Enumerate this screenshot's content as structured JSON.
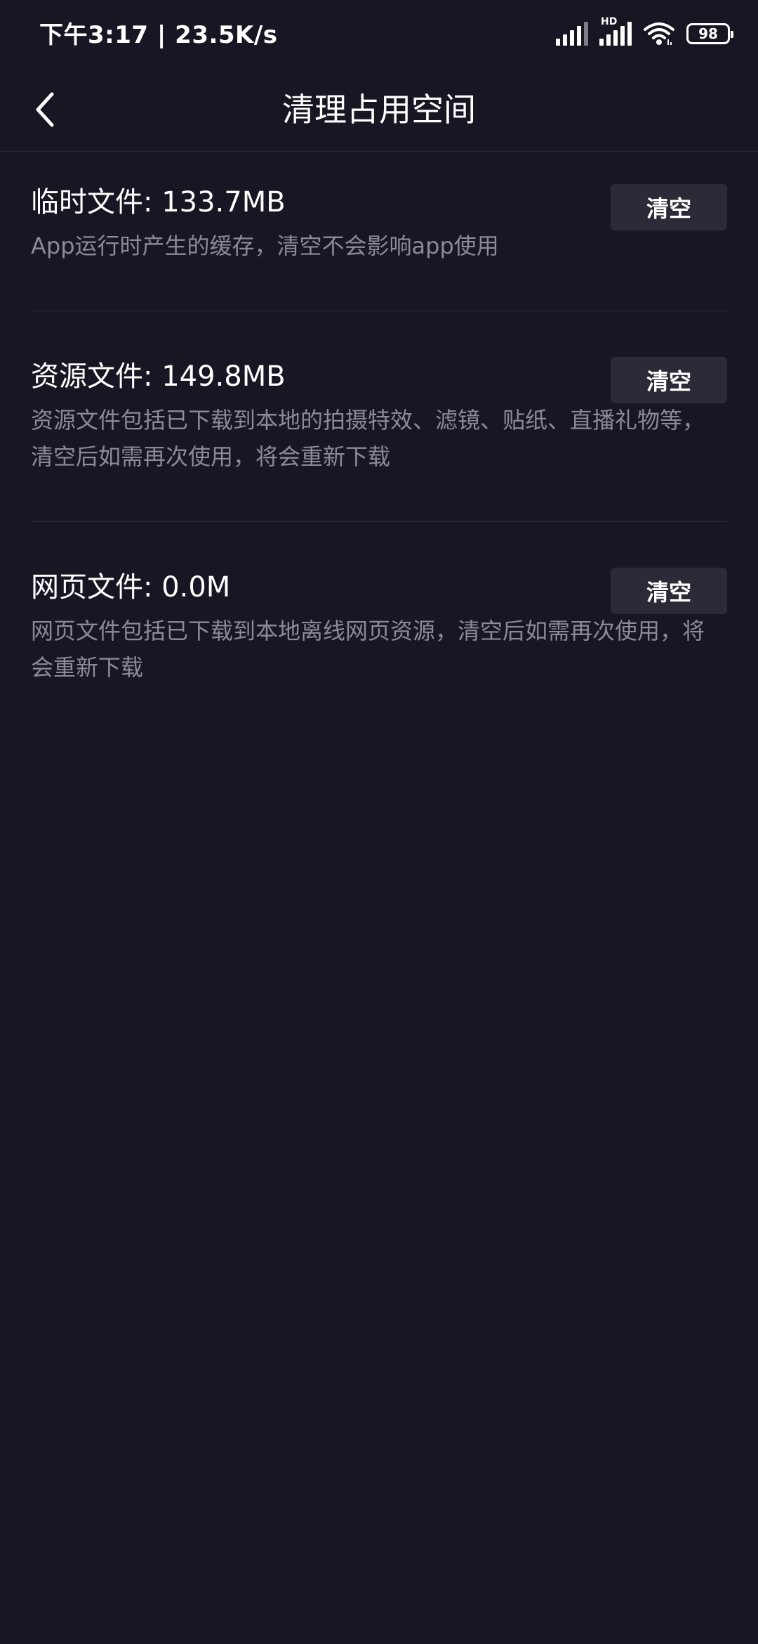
{
  "status_bar": {
    "time_speed": "下午3:17 | 23.5K/s",
    "network_label": "HD",
    "battery": "98",
    "icons": [
      "signal-icon",
      "signal-hd-icon",
      "wifi-icon",
      "battery-icon"
    ]
  },
  "nav": {
    "back_icon": "chevron-left-icon",
    "title": "清理占用空间"
  },
  "sections": [
    {
      "title": "临时文件: 133.7MB",
      "description": "App运行时产生的缓存，清空不会影响app使用",
      "button_label": "清空"
    },
    {
      "title": "资源文件: 149.8MB",
      "description": "资源文件包括已下载到本地的拍摄特效、滤镜、贴纸、直播礼物等，清空后如需再次使用，将会重新下载",
      "button_label": "清空"
    },
    {
      "title": "网页文件: 0.0M",
      "description": "网页文件包括已下载到本地离线网页资源，清空后如需再次使用，将会重新下载",
      "button_label": "清空"
    }
  ],
  "colors": {
    "background": "#161722",
    "button_bg": "#2a2b36",
    "secondary_text": "#8a8b95"
  }
}
